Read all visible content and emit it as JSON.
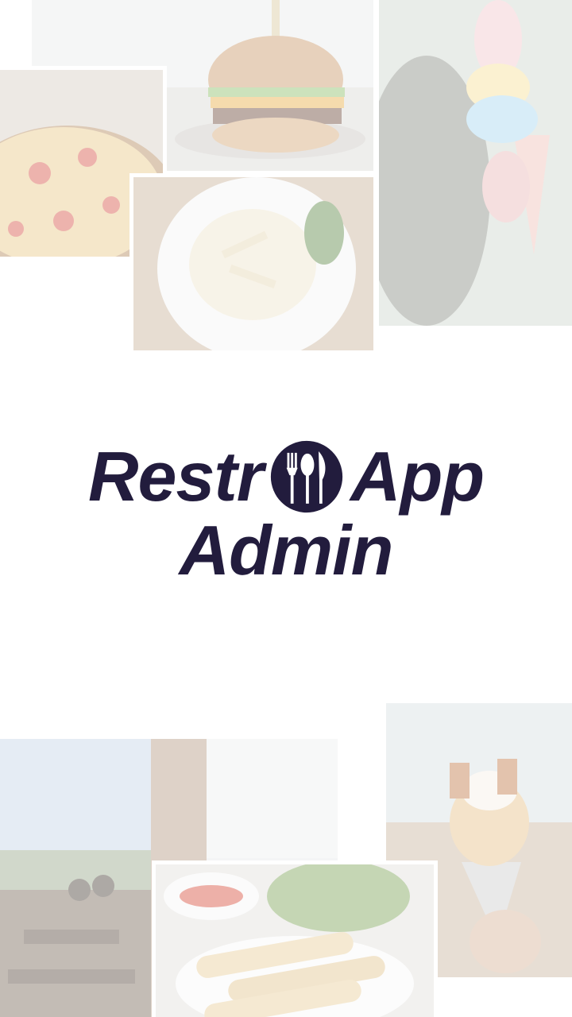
{
  "app": {
    "name_part1": "Restr",
    "name_part2": "App",
    "subtitle": "Admin"
  },
  "logo_icon": "fork-spoon-knife-icon",
  "colors": {
    "brand": "#221c3d",
    "background": "#ffffff"
  },
  "images": [
    {
      "subject": "pizza"
    },
    {
      "subject": "burger"
    },
    {
      "subject": "pasta"
    },
    {
      "subject": "ice-cream-cone"
    },
    {
      "subject": "restaurant-interior"
    },
    {
      "subject": "spring-rolls"
    },
    {
      "subject": "churros-cone"
    }
  ]
}
